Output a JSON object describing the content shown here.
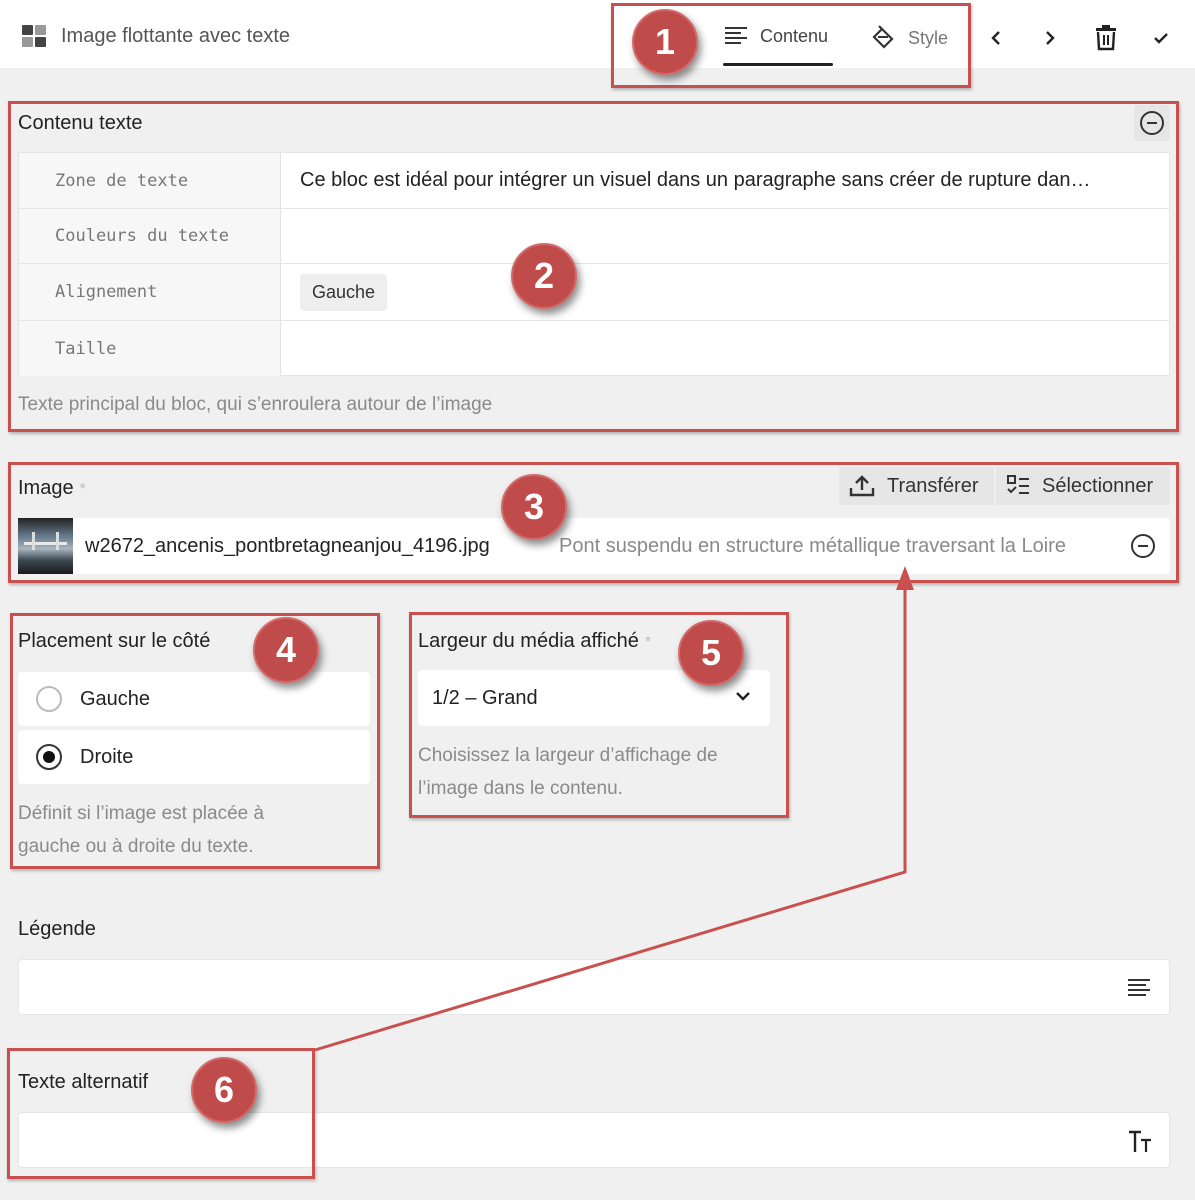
{
  "header": {
    "block_icon": "blocks-grid-icon",
    "block_title": "Image flottante avec texte",
    "tabs": [
      {
        "label": "Contenu",
        "icon": "align-left-icon",
        "active": true
      },
      {
        "label": "Style",
        "icon": "paint-bucket-icon",
        "active": false
      }
    ],
    "actions": [
      "chevron-left-icon",
      "chevron-right-icon",
      "trash-icon",
      "check-icon"
    ]
  },
  "annotations": [
    "1",
    "2",
    "3",
    "4",
    "5",
    "6"
  ],
  "text_section": {
    "label": "Contenu texte",
    "rows": [
      {
        "key": "Zone de texte",
        "value": "Ce bloc est idéal pour intégrer un visuel dans un paragraphe sans créer de rupture dan…"
      },
      {
        "key": "Couleurs du texte",
        "value": ""
      },
      {
        "key": "Alignement",
        "value": "Gauche"
      },
      {
        "key": "Taille",
        "value": ""
      }
    ],
    "help": "Texte principal du bloc, qui s’enroulera autour de l’image"
  },
  "image_section": {
    "label": "Image",
    "required": "*",
    "upload_label": "Transférer",
    "select_label": "Sélectionner",
    "filename": "w2672_ancenis_pontbretagneanjou_4196.jpg",
    "description": "Pont suspendu en structure métallique traversant la Loire"
  },
  "placement": {
    "label": "Placement sur le côté",
    "options": [
      {
        "label": "Gauche",
        "checked": false
      },
      {
        "label": "Droite",
        "checked": true
      }
    ],
    "help_line1": "Définit si l’image est placée à",
    "help_line2": "gauche ou à droite du texte."
  },
  "media_width": {
    "label": "Largeur du média affiché",
    "required": "*",
    "value": "1/2 – Grand",
    "help_line1": "Choisissez la largeur d’affichage de",
    "help_line2": "l’image dans le contenu."
  },
  "caption": {
    "label": "Légende",
    "value": ""
  },
  "alt_text": {
    "label": "Texte alternatif",
    "value": ""
  },
  "colors": {
    "annotation": "#c04b4b",
    "frame": "#c9504f"
  }
}
